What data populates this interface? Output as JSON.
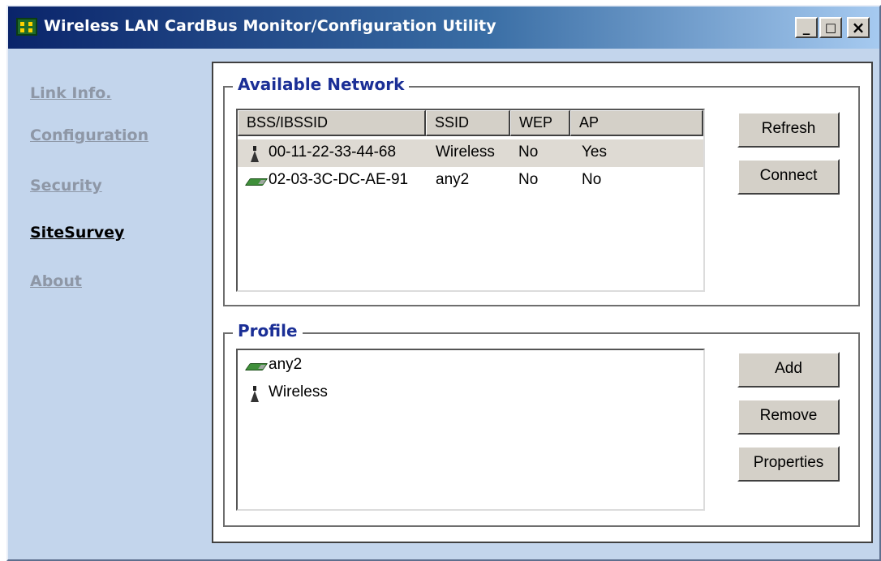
{
  "window": {
    "title": "Wireless LAN CardBus Monitor/Configuration Utility",
    "minimize_label": "_",
    "maximize_label": "□",
    "close_label": "×"
  },
  "sidebar": {
    "items": [
      {
        "label": "Link Info."
      },
      {
        "label": "Configuration"
      },
      {
        "label": "Security"
      },
      {
        "label": "SiteSurvey",
        "active": true
      },
      {
        "label": "About"
      }
    ]
  },
  "available_network": {
    "title": "Available Network",
    "columns": [
      "BSS/IBSSID",
      "SSID",
      "WEP",
      "AP"
    ],
    "rows": [
      {
        "icon": "access-point-icon",
        "bssid": "00-11-22-33-44-68",
        "ssid": "Wireless",
        "wep": "No",
        "ap": "Yes",
        "selected": true
      },
      {
        "icon": "network-card-icon",
        "bssid": "02-03-3C-DC-AE-91",
        "ssid": "any2",
        "wep": "No",
        "ap": "No",
        "selected": false
      }
    ],
    "buttons": {
      "refresh": "Refresh",
      "connect": "Connect"
    }
  },
  "profile": {
    "title": "Profile",
    "items": [
      {
        "icon": "network-card-icon",
        "label": "any2"
      },
      {
        "icon": "access-point-icon",
        "label": "Wireless"
      }
    ],
    "buttons": {
      "add": "Add",
      "remove": "Remove",
      "properties": "Properties"
    }
  },
  "colors": {
    "window_bg": "#c3d5ec",
    "title_gradient_start": "#0a246a",
    "title_gradient_end": "#a6caf0",
    "group_title": "#1b2f96",
    "sidebar_inactive": "#8e97a6",
    "selected_row": "#dedad3"
  }
}
